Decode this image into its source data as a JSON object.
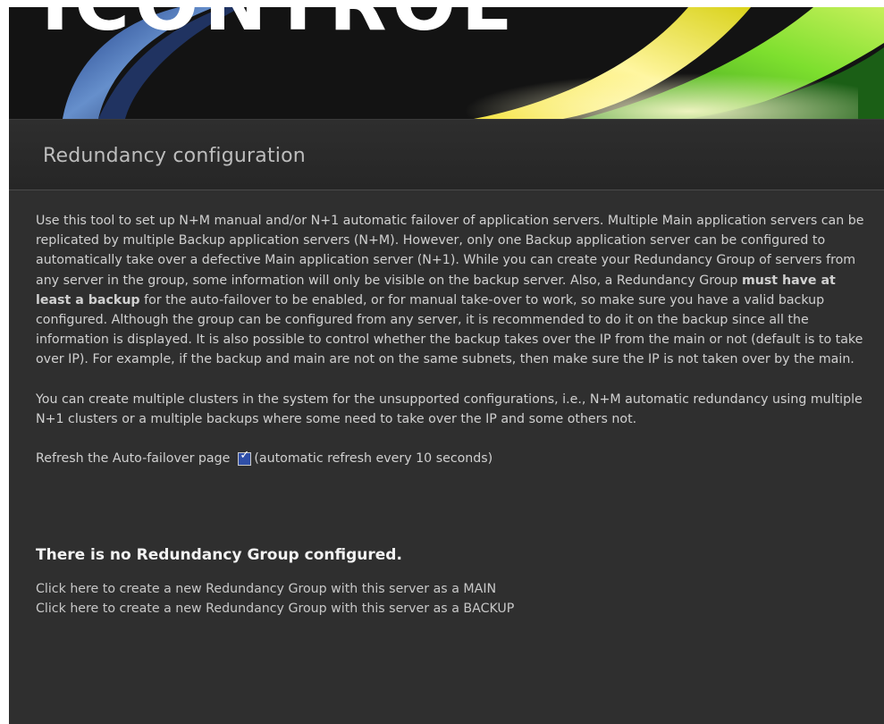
{
  "banner": {
    "logo_text": "ICONTROL"
  },
  "header": {
    "title": "Redundancy configuration"
  },
  "description": {
    "para1_before": "Use this tool to set up N+M manual and/or N+1 automatic failover of application servers. Multiple Main application servers can be replicated by multiple Backup application servers (N+M). However, only one Backup application server can be configured to automatically take over a defective Main application server (N+1). While you can create your Redundancy Group of servers from any server in the group, some information will only be visible on the backup server. Also, a Redundancy Group ",
    "para1_emphasis": "must have at least a backup",
    "para1_after": " for the auto-failover to be enabled, or for manual take-over to work, so make sure you have a valid backup configured. Although the group can be configured from any server, it is recommended to do it on the backup since all the information is displayed. It is also possible to control whether the backup takes over the IP from the main or not (default is to take over IP). For example, if the backup and main are not on the same subnets, then make sure the IP is not taken over by the main.",
    "para2": "You can create multiple clusters in the system for the unsupported configurations, i.e., N+M automatic redundancy using multiple N+1 clusters or a multiple backups where some need to take over the IP and some others not."
  },
  "refresh": {
    "label": "Refresh the Auto-failover page",
    "checked": true,
    "check_glyph": "✓",
    "note": "(automatic refresh every 10 seconds)"
  },
  "status": {
    "message": "There is no Redundancy Group configured."
  },
  "actions": {
    "create_main": "Click here to create a new Redundancy Group with this server as a MAIN",
    "create_backup": "Click here to create a new Redundancy Group with this server as a BACKUP"
  },
  "colors": {
    "background": "#2f2f2f",
    "title_text": "#bdbdbd",
    "body_text": "#d0d0d0",
    "checkbox_fill": "#2f4fa8"
  }
}
